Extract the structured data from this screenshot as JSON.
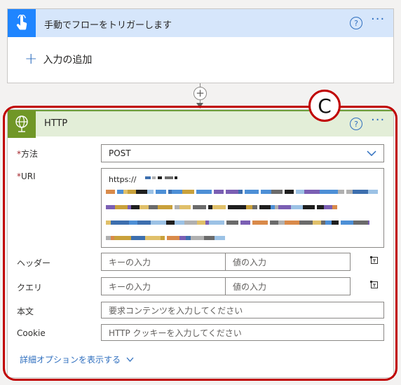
{
  "trigger": {
    "title": "手動でフローをトリガーします",
    "help_label": "?",
    "more_label": "···",
    "add_input_label": "入力の追加",
    "icon": "touch-hand-icon",
    "color": "#1f85ff"
  },
  "connector": {
    "add_label": "+"
  },
  "http": {
    "title": "HTTP",
    "icon": "globe-icon",
    "color": "#709727",
    "help_label": "?",
    "more_label": "···",
    "method": {
      "label": "方法",
      "value": "POST"
    },
    "uri": {
      "label": "URI",
      "prefix": "https://"
    },
    "headers": {
      "label": "ヘッダー",
      "key_placeholder": "キーの入力",
      "value_placeholder": "値の入力"
    },
    "query": {
      "label": "クエリ",
      "key_placeholder": "キーの入力",
      "value_placeholder": "値の入力"
    },
    "body": {
      "label": "本文",
      "placeholder": "要求コンテンツを入力してください"
    },
    "cookie": {
      "label": "Cookie",
      "placeholder": "HTTP クッキーを入力してください"
    },
    "advanced_label": "詳細オプションを表示する"
  },
  "annotation": {
    "badge_label": "C",
    "color": "#c00000"
  },
  "colors": {
    "accent": "#2f6fbf",
    "required": "#a4262c"
  }
}
